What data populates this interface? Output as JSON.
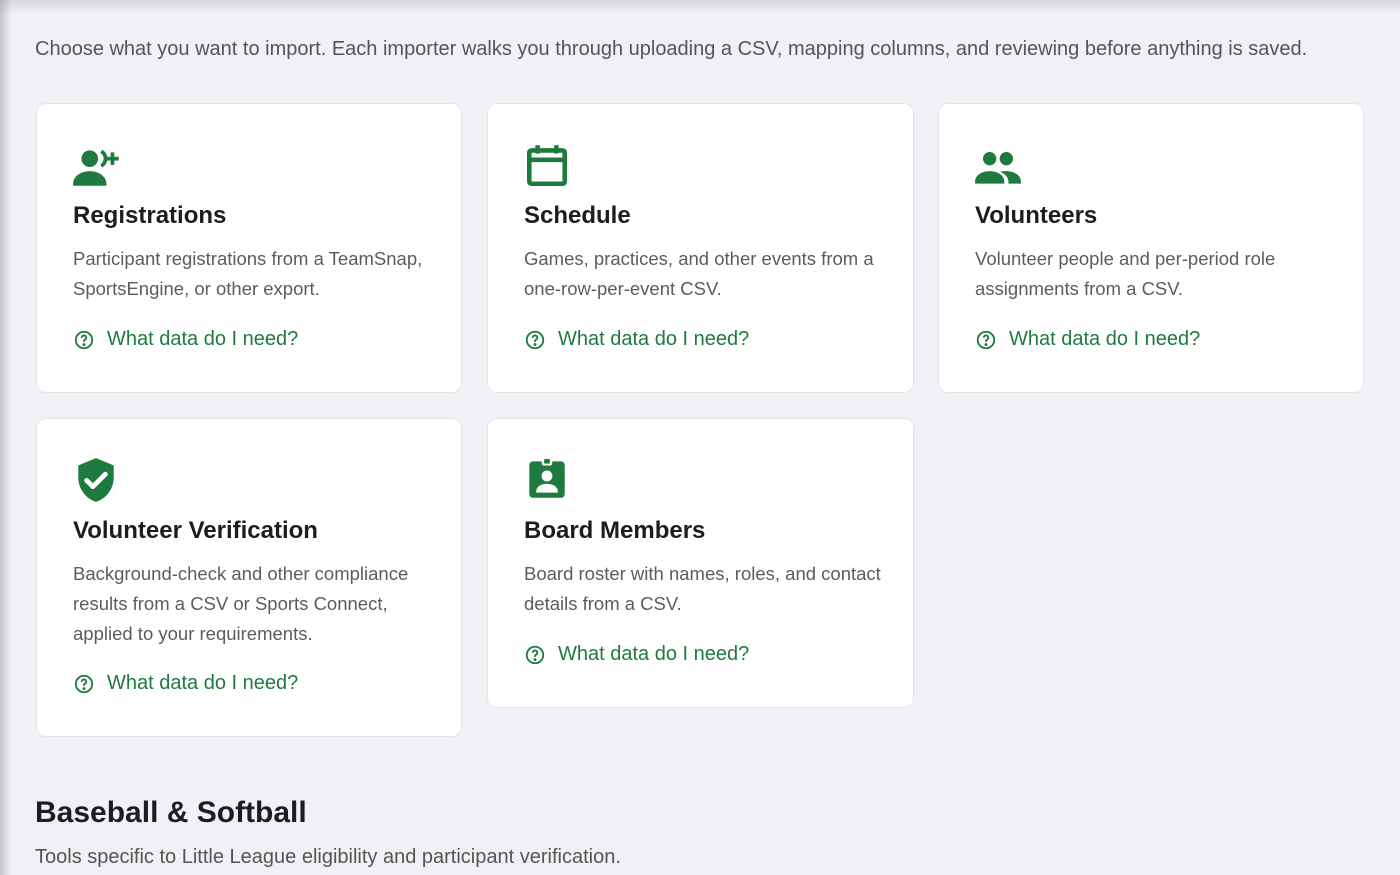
{
  "intro": "Choose what you want to import. Each importer walks you through uploading a CSV, mapping columns, and reviewing before anything is saved.",
  "accent_color": "#1f7a3f",
  "cards": [
    {
      "icon": "person-add-icon",
      "title": "Registrations",
      "description": "Participant registrations from a TeamSnap, SportsEngine, or other export.",
      "help": "What data do I need?"
    },
    {
      "icon": "calendar-icon",
      "title": "Schedule",
      "description": "Games, practices, and other events from a one-row-per-event CSV.",
      "help": "What data do I need?"
    },
    {
      "icon": "people-icon",
      "title": "Volunteers",
      "description": "Volunteer people and per-period role assignments from a CSV.",
      "help": "What data do I need?"
    },
    {
      "icon": "verified-shield-icon",
      "title": "Volunteer Verification",
      "description": "Background-check and other compliance results from a CSV or Sports Connect, applied to your requirements.",
      "help": "What data do I need?"
    },
    {
      "icon": "badge-icon",
      "title": "Board Members",
      "description": "Board roster with names, roles, and contact details from a CSV.",
      "help": "What data do I need?"
    }
  ],
  "section": {
    "title": "Baseball & Softball",
    "subtitle": "Tools specific to Little League eligibility and participant verification."
  }
}
